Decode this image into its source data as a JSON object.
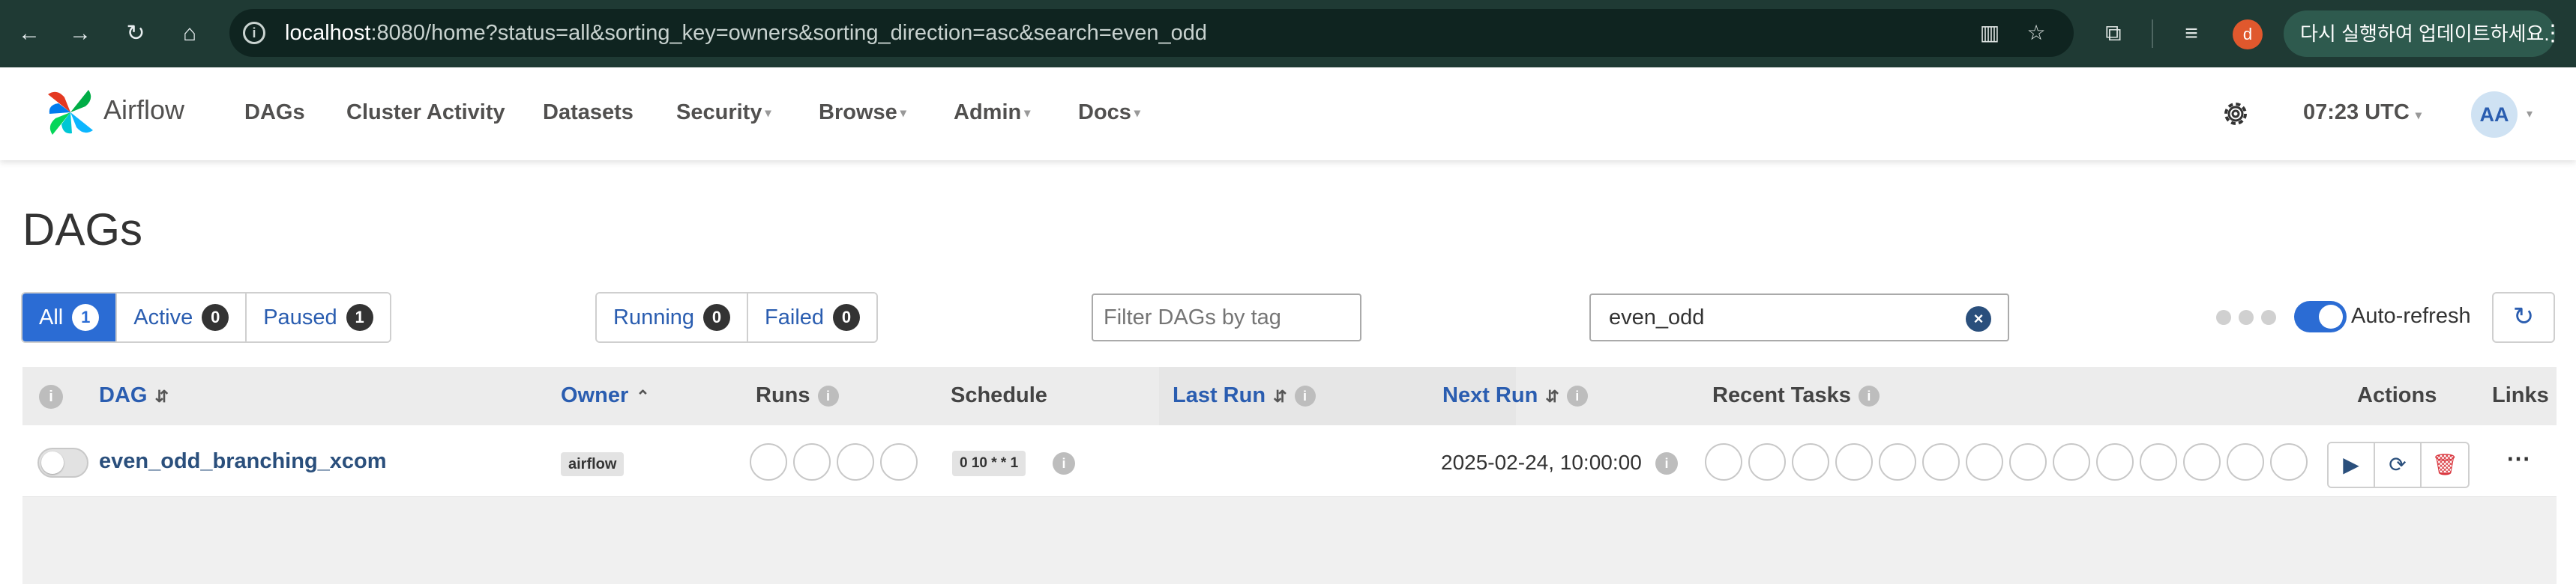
{
  "browser": {
    "url_host": "localhost",
    "url_rest": ":8080/home?status=all&sorting_key=owners&sorting_direction=asc&search=even_odd",
    "profile_initial": "d",
    "update_label": "다시 실행하여 업데이트하세요."
  },
  "navbar": {
    "brand": "Airflow",
    "items": [
      "DAGs",
      "Cluster Activity",
      "Datasets",
      "Security",
      "Browse",
      "Admin",
      "Docs"
    ],
    "time": "07:23 UTC",
    "avatar": "AA"
  },
  "page": {
    "title": "DAGs"
  },
  "filters": {
    "status": [
      {
        "label": "All",
        "count": "1"
      },
      {
        "label": "Active",
        "count": "0"
      },
      {
        "label": "Paused",
        "count": "1"
      }
    ],
    "run_state": [
      {
        "label": "Running",
        "count": "0"
      },
      {
        "label": "Failed",
        "count": "0"
      }
    ],
    "tag_placeholder": "Filter DAGs by tag",
    "search_value": "even_odd",
    "auto_refresh_label": "Auto-refresh"
  },
  "table": {
    "headers": {
      "dag": "DAG",
      "owner": "Owner",
      "runs": "Runs",
      "schedule": "Schedule",
      "last_run": "Last Run",
      "next_run": "Next Run",
      "recent_tasks": "Recent Tasks",
      "actions": "Actions",
      "links": "Links"
    },
    "rows": [
      {
        "dag_id": "even_odd_branching_xcom",
        "owner": "airflow",
        "schedule": "0 10 * * 1",
        "last_run": "",
        "next_run": "2025-02-24, 10:00:00",
        "paused": true
      }
    ]
  },
  "colors": {
    "accent": "#2b6cd4",
    "link": "#2a5db0",
    "delete": "#d9363e",
    "chrome_bg": "#1f3a34"
  }
}
